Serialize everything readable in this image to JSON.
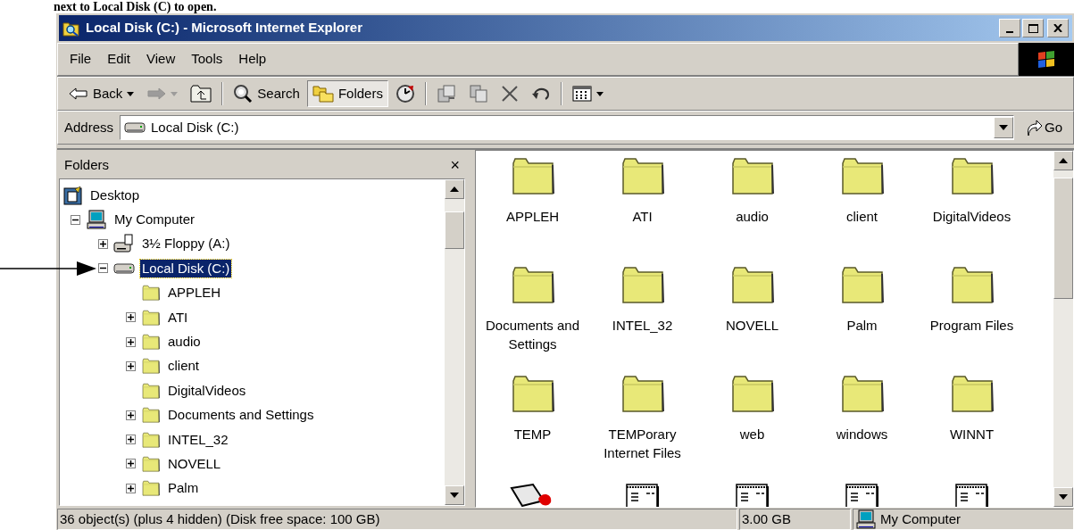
{
  "caption": "next to Local Disk (C) to open.",
  "window": {
    "title": "Local Disk (C:) - Microsoft Internet Explorer"
  },
  "menu": [
    {
      "label": "File"
    },
    {
      "label": "Edit"
    },
    {
      "label": "View"
    },
    {
      "label": "Tools"
    },
    {
      "label": "Help"
    }
  ],
  "toolbar": [
    {
      "kind": "back",
      "label": "Back",
      "dropdown": true,
      "disabled": false,
      "selected": false
    },
    {
      "kind": "forward",
      "dropdown": true,
      "disabled": true,
      "selected": false
    },
    {
      "kind": "up",
      "dropdown": false,
      "disabled": false,
      "selected": false
    },
    {
      "kind": "separator"
    },
    {
      "kind": "search",
      "label": "Search",
      "dropdown": false,
      "disabled": false,
      "selected": false
    },
    {
      "kind": "folders",
      "label": "Folders",
      "dropdown": false,
      "disabled": false,
      "selected": true
    },
    {
      "kind": "history",
      "dropdown": false,
      "disabled": false,
      "selected": false
    },
    {
      "kind": "separator"
    },
    {
      "kind": "move",
      "dropdown": false,
      "disabled": false,
      "selected": false
    },
    {
      "kind": "copy",
      "dropdown": false,
      "disabled": false,
      "selected": false
    },
    {
      "kind": "delete",
      "dropdown": false,
      "disabled": false,
      "selected": false
    },
    {
      "kind": "undo",
      "dropdown": false,
      "disabled": false,
      "selected": false
    },
    {
      "kind": "separator"
    },
    {
      "kind": "views",
      "dropdown": true,
      "disabled": false,
      "selected": false
    }
  ],
  "address": {
    "label": "Address",
    "value": "Local Disk (C:)",
    "go": "Go"
  },
  "folders_pane": {
    "title": "Folders",
    "close": "×"
  },
  "tree": [
    {
      "label": "Desktop",
      "kind": "desktop",
      "selected": false,
      "children": [
        {
          "label": "My Computer",
          "kind": "computer",
          "expanded": true,
          "selected": false,
          "children": [
            {
              "label": "3½ Floppy (A:)",
              "kind": "floppy",
              "expanded": false,
              "selected": false
            },
            {
              "label": "Local Disk (C:)",
              "kind": "drive",
              "expanded": true,
              "selected": true,
              "children": [
                {
                  "label": "APPLEH",
                  "kind": "folder",
                  "selected": false
                },
                {
                  "label": "ATI",
                  "kind": "folder",
                  "expanded": false,
                  "selected": false
                },
                {
                  "label": "audio",
                  "kind": "folder",
                  "expanded": false,
                  "selected": false
                },
                {
                  "label": "client",
                  "kind": "folder",
                  "expanded": false,
                  "selected": false
                },
                {
                  "label": "DigitalVideos",
                  "kind": "folder",
                  "selected": false
                },
                {
                  "label": "Documents and Settings",
                  "kind": "folder",
                  "expanded": false,
                  "selected": false
                },
                {
                  "label": "INTEL_32",
                  "kind": "folder",
                  "expanded": false,
                  "selected": false
                },
                {
                  "label": "NOVELL",
                  "kind": "folder",
                  "expanded": false,
                  "selected": false
                },
                {
                  "label": "Palm",
                  "kind": "folder",
                  "expanded": false,
                  "selected": false
                }
              ]
            }
          ]
        }
      ]
    }
  ],
  "files": [
    {
      "label": "APPLEH",
      "kind": "folder"
    },
    {
      "label": "ATI",
      "kind": "folder"
    },
    {
      "label": "audio",
      "kind": "folder"
    },
    {
      "label": "client",
      "kind": "folder"
    },
    {
      "label": "DigitalVideos",
      "kind": "folder"
    },
    {
      "label": "Documents and Settings",
      "kind": "folder"
    },
    {
      "label": "INTEL_32",
      "kind": "folder"
    },
    {
      "label": "NOVELL",
      "kind": "folder"
    },
    {
      "label": "Palm",
      "kind": "folder"
    },
    {
      "label": "Program Files",
      "kind": "folder"
    },
    {
      "label": "TEMP",
      "kind": "folder"
    },
    {
      "label": "TEMPorary Internet Files",
      "kind": "folder"
    },
    {
      "label": "web",
      "kind": "folder"
    },
    {
      "label": "windows",
      "kind": "folder"
    },
    {
      "label": "WINNT",
      "kind": "folder"
    },
    {
      "kind": "application"
    },
    {
      "kind": "document"
    },
    {
      "kind": "document"
    },
    {
      "kind": "document"
    },
    {
      "kind": "document"
    }
  ],
  "status_bar": {
    "message": "36 object(s) (plus 4 hidden) (Disk free space: 100 GB)",
    "size": "3.00 GB",
    "zone": "My Computer"
  }
}
